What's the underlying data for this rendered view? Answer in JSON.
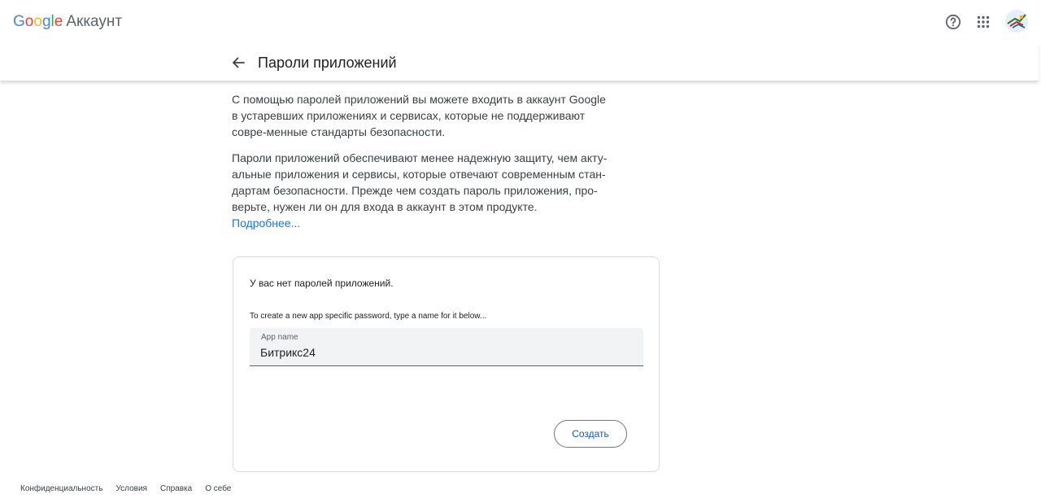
{
  "header": {
    "logo_google": "Google",
    "logo_product": "Аккаунт",
    "help_icon": "help-circle-icon",
    "apps_icon": "apps-grid-icon",
    "avatar": "user-avatar"
  },
  "subheader": {
    "back_icon": "arrow-back-icon",
    "title": "Пароли приложений"
  },
  "content": {
    "paragraph1": "С помощью паролей приложений вы можете входить в аккаунт Google в устаревших приложениях и сервисах, которые не поддерживают совре-менные стандарты безопасности.",
    "paragraph2": "Пароли приложений обеспечивают менее надежную защиту, чем акту-альные приложения и сервисы, которые отвечают современным стан-дартам безопасности. Прежде чем создать пароль приложения, про-верьте, нужен ли он для входа в аккаунт в этом продукте.",
    "more_link": "Подробнее..."
  },
  "card": {
    "no_passwords": "У вас нет паролей приложений.",
    "hint": "To create a new app specific password, type a name for it below...",
    "field_label": "App name",
    "field_value": "Битрикс24",
    "create_button": "Создать"
  },
  "footer": {
    "links": [
      "Конфиденциальность",
      "Условия",
      "Справка",
      "О себе"
    ]
  },
  "colors": {
    "accent": "#1a73e8",
    "button_text": "#0b57d0",
    "field_bg": "#f1f3f4",
    "border": "#dadce0"
  }
}
